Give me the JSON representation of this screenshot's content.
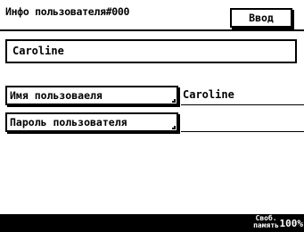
{
  "header": {
    "title": "Инфо пользователя#000",
    "enter_label": "Ввод"
  },
  "main": {
    "current_value": "Caroline",
    "fields": [
      {
        "label": "Имя пользоваеля",
        "value": "Caroline"
      },
      {
        "label": "Пароль пользователя",
        "value": ""
      }
    ]
  },
  "status": {
    "memory_line1": "Своб.",
    "memory_line2": "память",
    "memory_pct": "100%"
  },
  "colors": {
    "background": "#ffffff",
    "foreground": "#000000"
  }
}
